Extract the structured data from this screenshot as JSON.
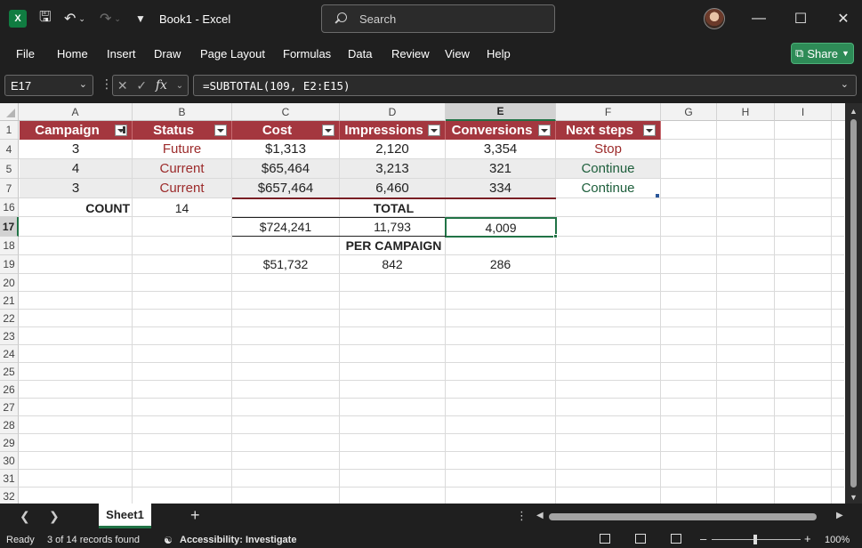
{
  "app": {
    "logo_letter": "X",
    "doc_name": "Book1",
    "app_name": "Excel",
    "title": "Book1  -  Excel",
    "search_placeholder": "Search"
  },
  "menu": [
    "File",
    "Home",
    "Insert",
    "Draw",
    "Page Layout",
    "Formulas",
    "Data",
    "Review",
    "View",
    "Help"
  ],
  "share_label": "Share",
  "formula_bar": {
    "name_box": "E17",
    "formula": "=SUBTOTAL(109, E2:E15)",
    "fx": "fx"
  },
  "columns": [
    "A",
    "B",
    "C",
    "D",
    "E",
    "F",
    "G",
    "H",
    "I"
  ],
  "selected_column": "E",
  "rows": [
    "1",
    "4",
    "5",
    "7",
    "16",
    "17",
    "18",
    "19",
    "20",
    "21",
    "22",
    "23",
    "24",
    "25",
    "26",
    "27",
    "28",
    "29",
    "30",
    "31",
    "32"
  ],
  "selected_row": "17",
  "table": {
    "headers": [
      "Campaign",
      "Status",
      "Cost",
      "Impressions",
      "Conversions",
      "Next steps"
    ],
    "data_rows": [
      {
        "campaign": "3",
        "status": "Future",
        "cost": "$1,313",
        "impressions": "2,120",
        "conversions": "3,354",
        "next": "Stop"
      },
      {
        "campaign": "4",
        "status": "Current",
        "cost": "$65,464",
        "impressions": "3,213",
        "conversions": "321",
        "next": "Continue"
      },
      {
        "campaign": "3",
        "status": "Current",
        "cost": "$657,464",
        "impressions": "6,460",
        "conversions": "334",
        "next": "Continue"
      }
    ]
  },
  "summary": {
    "count_label": "COUNT",
    "count_value": "14",
    "total_label": "TOTAL",
    "total_cost": "$724,241",
    "total_impressions": "11,793",
    "total_conversions": "4,009",
    "per_campaign_label": "PER CAMPAIGN",
    "per_cost": "$51,732",
    "per_impressions": "842",
    "per_conversions": "286"
  },
  "sheet_tab": "Sheet1",
  "status": {
    "ready": "Ready",
    "records": "3 of 14 records found",
    "accessibility": "Accessibility: Investigate",
    "zoom": "100%"
  }
}
